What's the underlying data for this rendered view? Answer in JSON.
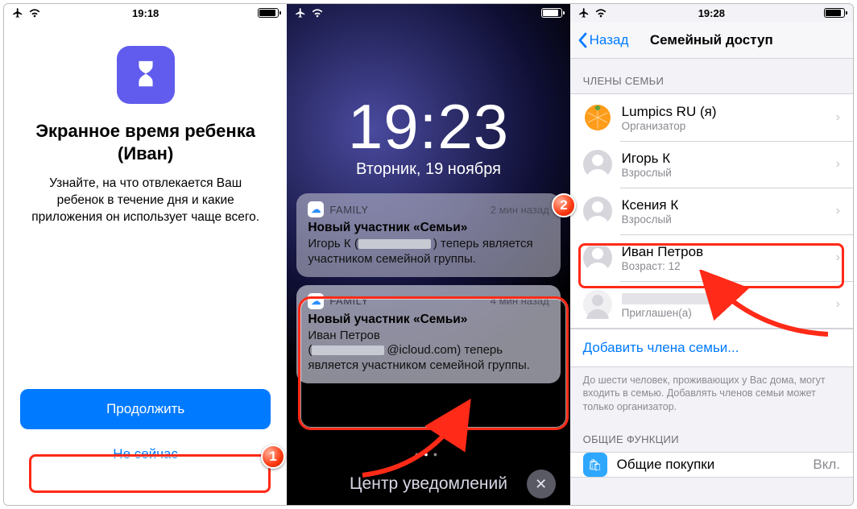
{
  "pane1": {
    "status_time": "19:18",
    "title_l1": "Экранное время ребенка",
    "title_l2": "(Иван)",
    "desc": "Узнайте, на что отвлекается Ваш ребенок в течение дня и какие приложения он использует чаще всего.",
    "continue": "Продолжить",
    "not_now": "Не сейчас"
  },
  "pane2": {
    "lock_time": "19:23",
    "lock_date": "Вторник, 19 ноября",
    "notifs": [
      {
        "app": "FAMILY",
        "time": "2 мин назад",
        "title": "Новый участник «Семьи»",
        "body_prefix": "Игорь К (",
        "body_suffix": ") теперь является участником семейной группы."
      },
      {
        "app": "FAMILY",
        "time": "4 мин назад",
        "title": "Новый участник «Семьи»",
        "body_l1": "Иван Петров",
        "body_prefix": "(",
        "body_email_suffix": "@icloud.com",
        "body_suffix": ") теперь является участником семейной группы."
      }
    ],
    "nc_label": "Центр уведомлений"
  },
  "pane3": {
    "status_time": "19:28",
    "back": "Назад",
    "title": "Семейный доступ",
    "section_members": "ЧЛЕНЫ СЕМЬИ",
    "members": [
      {
        "name": "Lumpics RU (я)",
        "sub": "Организатор"
      },
      {
        "name": "Игорь К",
        "sub": "Взрослый"
      },
      {
        "name": "Ксения К",
        "sub": "Взрослый"
      },
      {
        "name": "Иван Петров",
        "sub": "Возраст: 12"
      },
      {
        "name": "",
        "sub": "Приглашен(а)"
      }
    ],
    "add_member": "Добавить члена семьи...",
    "footer": "До шести человек, проживающих у Вас дома, могут входить в семью. Добавлять членов семьи может только организатор.",
    "section_shared": "ОБЩИЕ ФУНКЦИИ",
    "shared_item": "Общие покупки",
    "shared_status": "Вкл."
  },
  "markers": {
    "m1": "1",
    "m2": "2"
  }
}
